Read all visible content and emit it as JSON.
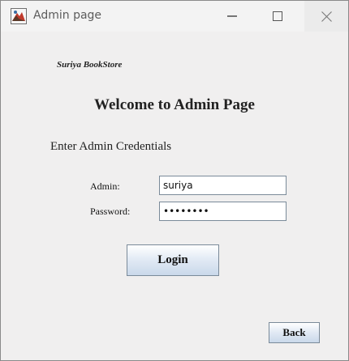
{
  "window": {
    "title": "Admin page"
  },
  "header": {
    "store_name": "Suriya BookStore",
    "heading": "Welcome to Admin Page",
    "subheading": "Enter Admin Credentials"
  },
  "form": {
    "admin_label": "Admin:",
    "admin_value": "suriya",
    "password_label": "Password:",
    "password_value": "••••••••"
  },
  "buttons": {
    "login_label": "Login",
    "back_label": "Back"
  }
}
